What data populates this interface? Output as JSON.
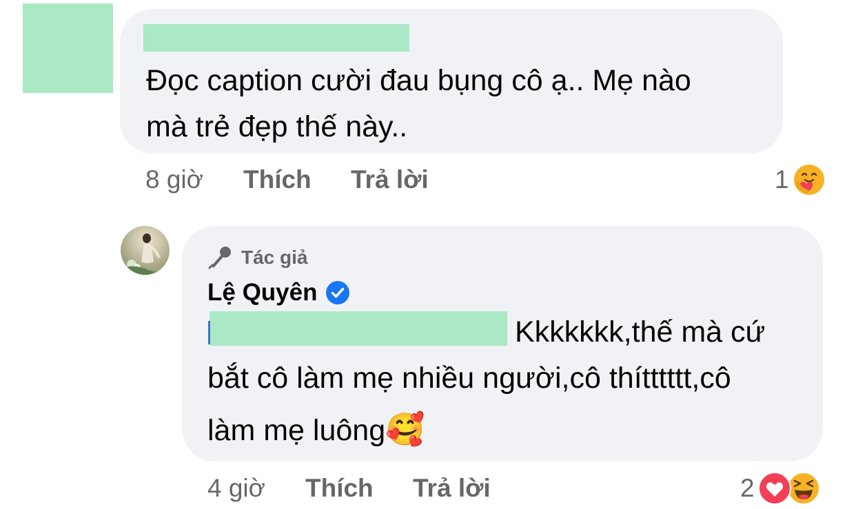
{
  "comment1": {
    "text_line1": "Đọc caption cười đau bụng cô ạ.. Mẹ nào",
    "text_line2": "mà trẻ đẹp thế này..",
    "time": "8 giờ",
    "like": "Thích",
    "reply": "Trả lời",
    "reaction_count": "1",
    "reactions": [
      "care-icon"
    ]
  },
  "comment2": {
    "author_badge": "Tác giả",
    "author_name": "Lệ Quyên",
    "text_line1": "Kkkkkkk,thế mà cứ",
    "text_line2": "bắt cô làm mẹ nhiều người,cô thítttttt,cô",
    "text_line3": "làm mẹ luông",
    "emoji": "🥰",
    "time": "4 giờ",
    "like": "Thích",
    "reply": "Trả lời",
    "reaction_count": "2",
    "reactions": [
      "love-icon",
      "haha-icon"
    ]
  },
  "colors": {
    "bubble": "#f0f2f5",
    "text": "#050505",
    "meta": "#65676b",
    "verified": "#1877f2",
    "redaction": "#abe8c5",
    "love": "#f33e58"
  }
}
